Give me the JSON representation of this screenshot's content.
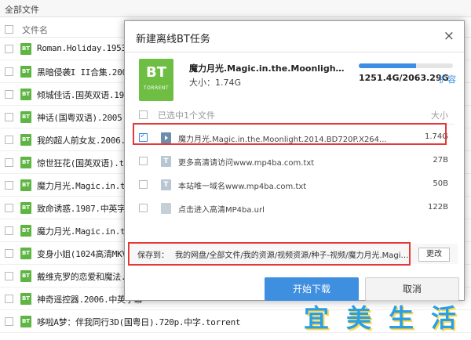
{
  "topbar": {
    "title": "全部文件"
  },
  "list": {
    "header": "文件名",
    "rows": [
      "Roman.Holiday.1953.720p.BluRay",
      "黑暗侵袭I II合集.2005-2009",
      "倾城佳话.国英双语.1994.",
      "神话(国粤双语).2005.中文",
      "我的超人前女友.2006.中英",
      "惊世狂花(国英双语).torrent",
      "魔力月光.Magic.in.the.Moo",
      "致命诱惑.1987.中英字幕.",
      "魔力月光.Magic.in.the.Moo",
      "变身小姐(1024高清MKV版HD",
      "戴维克罗的恋爱和魔法.Mir",
      "神奇遥控器.2006.中英字幕",
      "哆啦A梦：伴我同行3D(国粤日).720p.中字.torrent"
    ],
    "bt_label": "BT"
  },
  "dialog": {
    "title": "新建离线BT任务",
    "close": "×",
    "torrent_icon_big": "BT",
    "torrent_icon_small": "TORRENT",
    "torrent_name": "魔力月光.Magic.in.the.Moonlight.2014.BD720P.X264.AAC.English.CHS-ENG.Mp4Ba.torrent",
    "size_label": "大小：1.74G",
    "quota_text": "1251.4G/2063.29G",
    "quota_fraction": 0.606,
    "expand": "扩容",
    "selected_header": "已选中1个文件",
    "size_header": "大小",
    "files": [
      {
        "name": "魔力月光.Magic.in.the.Moonlight.2014.BD720P.X264...",
        "size": "1.74G",
        "icon": "video-icon",
        "checked": true
      },
      {
        "name": "更多高清请访问www.mp4ba.com.txt",
        "size": "27B",
        "icon": "txt-icon",
        "checked": false
      },
      {
        "name": "本站唯一域名www.mp4ba.com.txt",
        "size": "50B",
        "icon": "txt-icon",
        "checked": false
      },
      {
        "name": "点击进入高清MP4ba.url",
        "size": "122B",
        "icon": "url-icon",
        "checked": false
      }
    ],
    "save_label": "保存到：",
    "save_path": "我的网盘/全部文件/我的资源/视频资源/种子-视频/魔力月光.Magic.in.the...",
    "change": "更改",
    "start": "开始下载",
    "cancel": "取消"
  },
  "watermark": [
    "宜",
    "美",
    "生",
    "活"
  ],
  "colors": {
    "accent": "#3b8ee4",
    "bt_green": "#5fb543",
    "highlight": "#e53838"
  }
}
